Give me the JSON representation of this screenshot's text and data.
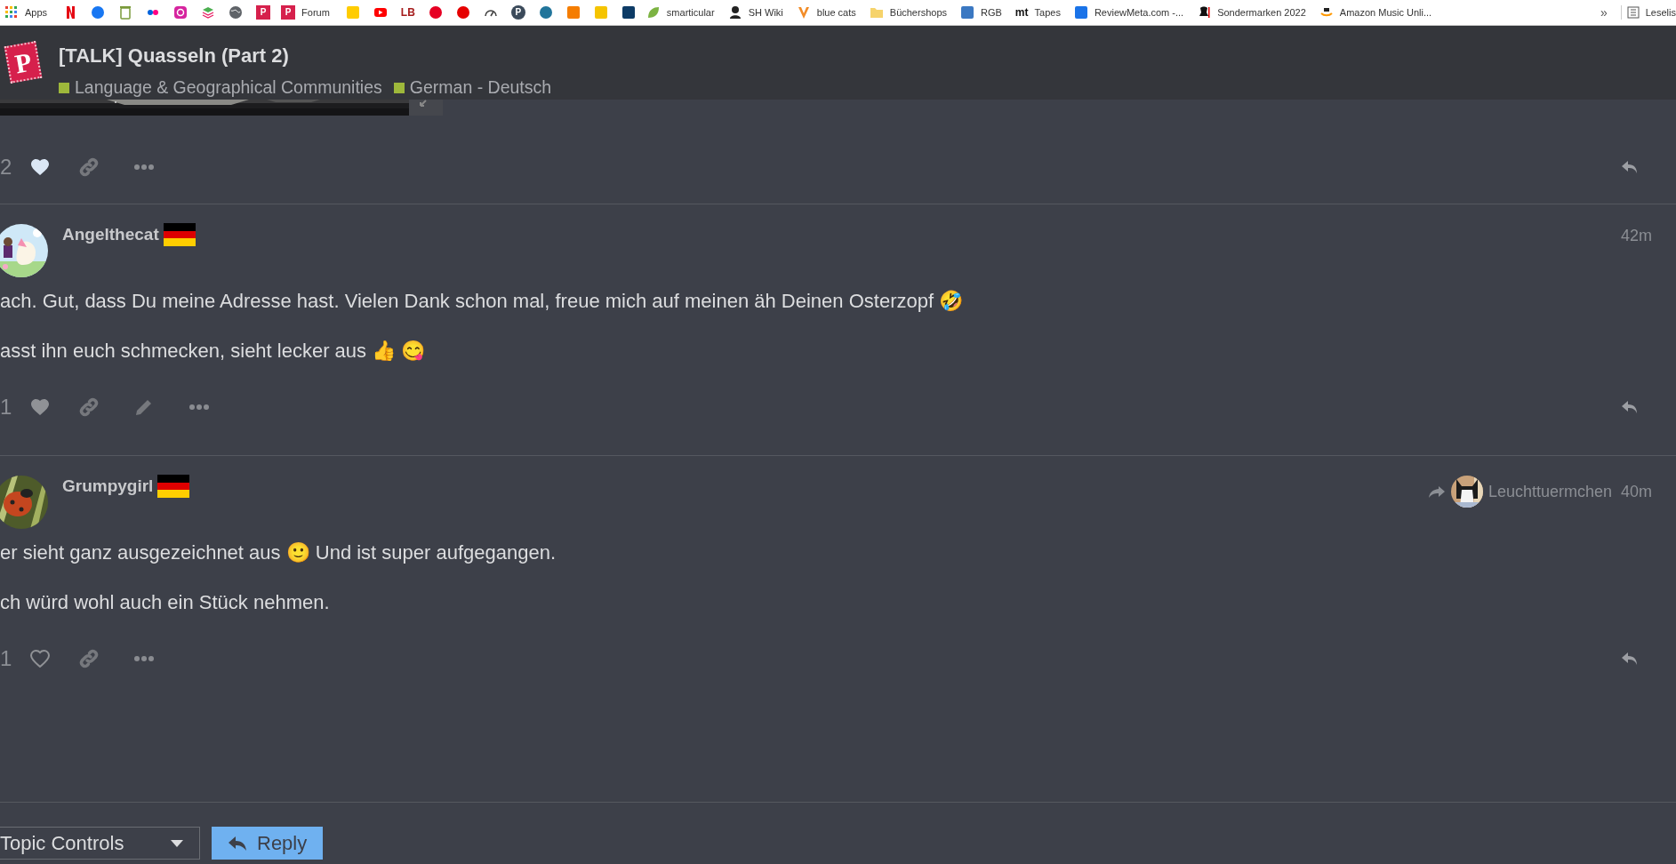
{
  "bookmarks": [
    {
      "kind": "labeled",
      "label": "Apps"
    },
    {
      "kind": "icon"
    },
    {
      "kind": "icon"
    },
    {
      "kind": "icon"
    },
    {
      "kind": "icon"
    },
    {
      "kind": "icon"
    },
    {
      "kind": "icon"
    },
    {
      "kind": "icon"
    },
    {
      "kind": "icon",
      "icon_text": "P"
    },
    {
      "kind": "labeled",
      "label": "Forum",
      "icon_text": "P"
    },
    {
      "kind": "icon"
    },
    {
      "kind": "icon"
    },
    {
      "kind": "icon",
      "icon_text": "LB"
    },
    {
      "kind": "icon"
    },
    {
      "kind": "icon"
    },
    {
      "kind": "icon"
    },
    {
      "kind": "icon",
      "icon_text": "P"
    },
    {
      "kind": "icon"
    },
    {
      "kind": "icon"
    },
    {
      "kind": "icon"
    },
    {
      "kind": "icon"
    },
    {
      "kind": "labeled",
      "label": "smarticular"
    },
    {
      "kind": "labeled",
      "label": "SH Wiki"
    },
    {
      "kind": "labeled",
      "label": "blue cats"
    },
    {
      "kind": "labeled",
      "label": "Büchershops"
    },
    {
      "kind": "labeled",
      "label": "RGB"
    },
    {
      "kind": "labeled",
      "label": "Tapes",
      "icon_text": "mt"
    },
    {
      "kind": "labeled",
      "label": "ReviewMeta.com -..."
    },
    {
      "kind": "labeled",
      "label": "Sondermarken 2022"
    },
    {
      "kind": "labeled",
      "label": "Amazon Music Unli..."
    }
  ],
  "bookmarks_more": "»",
  "reading_list": {
    "label": "Leselis"
  },
  "header": {
    "logo_letter": "P",
    "title": "[TALK] Quasseln (Part 2)",
    "categories": [
      {
        "name": "Language & Geographical Communities",
        "color": "#9eb83b"
      },
      {
        "name": "German - Deutsch",
        "color": "#9eb83b"
      }
    ]
  },
  "previous_post": {
    "likes": "2",
    "liked": true,
    "kind": "filled"
  },
  "posts": [
    {
      "username": "Angelthecat",
      "time": "42m",
      "paragraphs": [
        "ach. Gut, dass Du meine Adresse hast. Vielen Dank schon mal, freue mich auf meinen äh Deinen Osterzopf 🤣",
        "asst ihn euch schmecken, sieht lecker aus 👍 😋"
      ],
      "likes": "1",
      "liked": false,
      "kind": "filled",
      "can_edit": true
    },
    {
      "username": "Grumpygirl",
      "time": "40m",
      "reply_to": {
        "username": "Leuchttuermchen"
      },
      "paragraphs": [
        "er sieht ganz ausgezeichnet aus 🙂 Und ist super aufgegangen.",
        "ch würd wohl auch ein Stück nehmen."
      ],
      "likes": "1",
      "liked": false,
      "kind": "outline"
    }
  ],
  "footer": {
    "topic_controls": "Topic Controls",
    "reply_button": "Reply"
  }
}
